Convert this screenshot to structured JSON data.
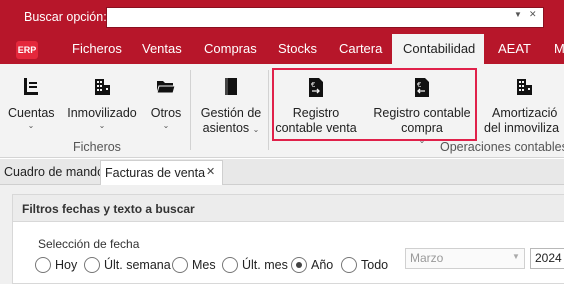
{
  "search": {
    "label": "Buscar opción:",
    "value": ""
  },
  "logo": "ERP",
  "menu": {
    "tabs": [
      "Ficheros",
      "Ventas",
      "Compras",
      "Stocks",
      "Cartera",
      "Contabilidad",
      "AEAT",
      "M"
    ],
    "active": "Contabilidad"
  },
  "ribbon": {
    "buttons": {
      "cuentas": "Cuentas",
      "inmovilizado": "Inmovilizado",
      "otros": "Otros",
      "gestion_1": "Gestión de",
      "gestion_2": "asientos",
      "registro_venta_1": "Registro",
      "registro_venta_2": "contable venta",
      "registro_compra_1": "Registro contable",
      "registro_compra_2": "compra",
      "amortizacion_1": "Amortizació",
      "amortizacion_2": "del inmoviliza"
    },
    "groups": {
      "ficheros": "Ficheros",
      "operaciones": "Operaciones contables"
    },
    "icons": [
      "ledger-icon",
      "building-icon",
      "folder-icon",
      "book-icon",
      "invoice-icon",
      "invoice-icon",
      "building-icon"
    ]
  },
  "doc_tabs": {
    "cuadro": "Cuadro de mando",
    "facturas": "Facturas de venta",
    "close": "✕"
  },
  "filters": {
    "title": "Filtros fechas y texto a buscar",
    "date_label": "Selección de fecha",
    "options": [
      "Hoy",
      "Últ. semana",
      "Mes",
      "Últ. mes",
      "Año",
      "Todo"
    ],
    "selected": "Año",
    "month": "Marzo",
    "year": "2024"
  },
  "colors": {
    "brand": "#b7162a",
    "highlight": "#e0214a"
  }
}
